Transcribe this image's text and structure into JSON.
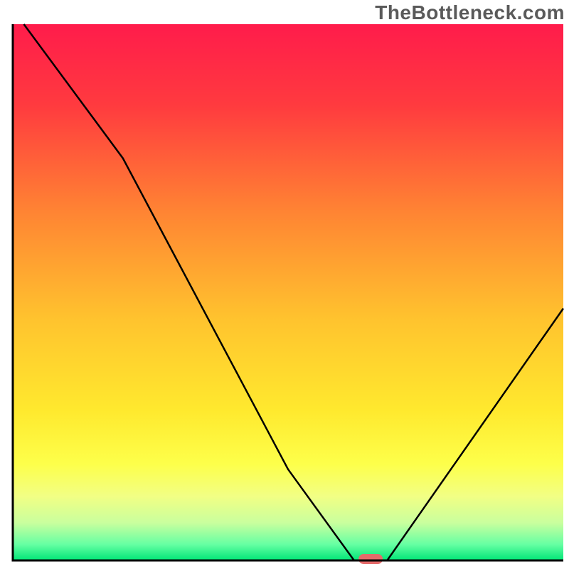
{
  "watermark": "TheBottleneck.com",
  "chart_data": {
    "type": "line",
    "title": "",
    "xlabel": "",
    "ylabel": "",
    "xlim": [
      0,
      100
    ],
    "ylim": [
      0,
      100
    ],
    "x": [
      2,
      20,
      50,
      62,
      68,
      100
    ],
    "values": [
      100,
      75,
      17,
      0,
      0,
      47
    ],
    "marker": {
      "x": 65,
      "y": 0,
      "color": "#e46a6a"
    },
    "gradient_stops": [
      {
        "offset": 0.0,
        "color": "#ff1c4b"
      },
      {
        "offset": 0.15,
        "color": "#ff3a3f"
      },
      {
        "offset": 0.35,
        "color": "#ff8433"
      },
      {
        "offset": 0.55,
        "color": "#ffc32e"
      },
      {
        "offset": 0.72,
        "color": "#ffe92e"
      },
      {
        "offset": 0.82,
        "color": "#fdff4a"
      },
      {
        "offset": 0.88,
        "color": "#f2ff84"
      },
      {
        "offset": 0.93,
        "color": "#c9ff9e"
      },
      {
        "offset": 0.97,
        "color": "#66ffa3"
      },
      {
        "offset": 1.0,
        "color": "#00e676"
      }
    ],
    "axis_color": "#000000"
  }
}
